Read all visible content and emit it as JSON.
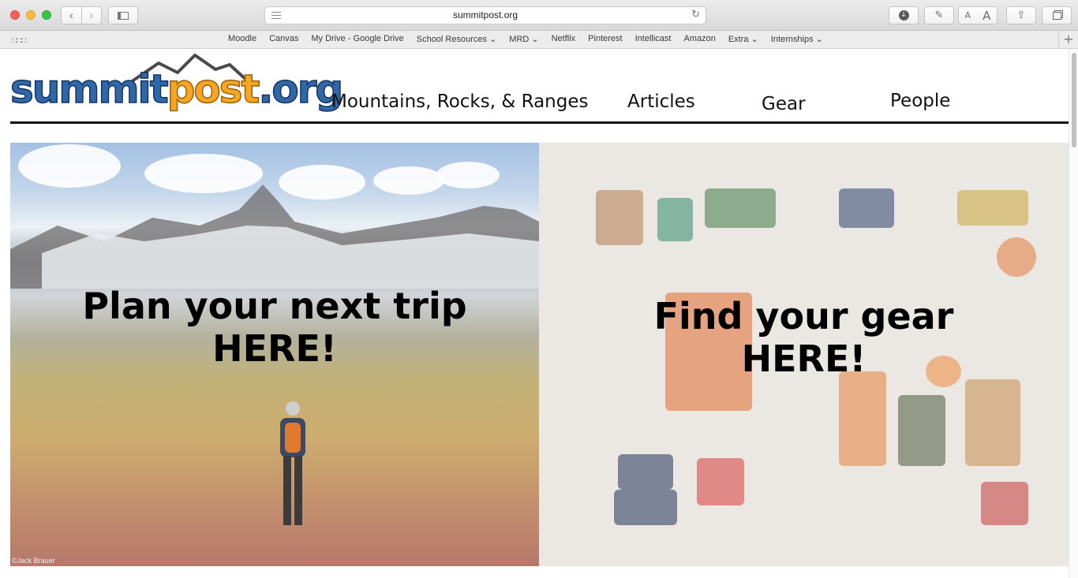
{
  "browser": {
    "url": "summitpost.org",
    "bookmarks": [
      "Moodle",
      "Canvas",
      "My Drive - Google Drive",
      "School Resources ⌄",
      "MRD ⌄",
      "Netflix",
      "Pinterest",
      "Intellicast",
      "Amazon",
      "Extra ⌄",
      "Internships ⌄"
    ],
    "text_size_small": "A",
    "text_size_large": "A"
  },
  "site": {
    "logo_part1": "summit",
    "logo_part2": "post",
    "logo_part3": ".org",
    "nav": [
      {
        "label": "Mountains, Rocks, & Ranges"
      },
      {
        "label": "Articles"
      },
      {
        "label": "Gear"
      },
      {
        "label": "People"
      }
    ]
  },
  "panels": {
    "trip": {
      "line1": "Plan your next trip",
      "line2": "HERE!",
      "credit": "©Jack Brauer"
    },
    "gear": {
      "line1": "Find your gear",
      "line2": "HERE!"
    }
  },
  "colors": {
    "logo_blue": "#2f67a8",
    "logo_orange": "#f6a623"
  }
}
